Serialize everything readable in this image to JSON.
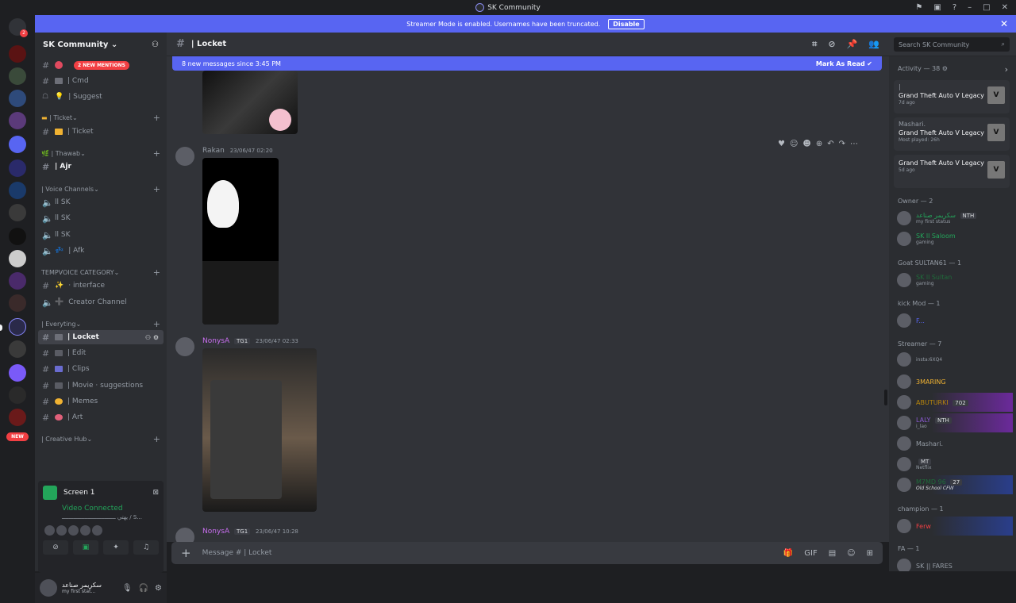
{
  "window": {
    "title": "SK Community"
  },
  "banner": {
    "text": "Streamer Mode is enabled. Usernames have been truncated.",
    "disable_label": "Disable"
  },
  "server": {
    "name": "SK Community"
  },
  "mentions_pill": "2 NEW MENTIONS",
  "channels_top": [
    {
      "label": "| Cmd"
    },
    {
      "label": "| Suggest"
    }
  ],
  "categories": [
    {
      "label": "| Ticket"
    },
    {
      "label": "| Thawab"
    },
    {
      "label": "| Voice Channels"
    },
    {
      "label": "TEMPVOICE CATEGORY"
    },
    {
      "label": "| Everyting"
    },
    {
      "label": "| Creative Hub"
    }
  ],
  "channels": {
    "ticket": "| Ticket",
    "ajr": "| Ajr",
    "voice1": "ll SK",
    "voice2": "ll SK",
    "voice3": "ll SK",
    "afk": "| Afk",
    "interface": "· interface",
    "creator": "Creator Channel",
    "locket": "| Locket",
    "edit": "| Edit",
    "clips": "| Clips",
    "movie": "| Movie · suggestions",
    "memes": "| Memes",
    "art": "| Art"
  },
  "voice": {
    "screen": "Screen 1",
    "status": "Video Connected",
    "sub": "يهتي ـــــــــــــــــــــــــــــــــ / S..."
  },
  "user": {
    "name": "سكريمر صناعد",
    "status": "my first stat..."
  },
  "header": {
    "channel": "| Locket",
    "search_placeholder": "Search SK Community"
  },
  "chat": {
    "new_messages": "8 new messages since 3:45 PM",
    "mark_read": "Mark As Read",
    "messages": [
      {
        "author": "Rakan",
        "time": "23/06/47 02:20"
      },
      {
        "author": "NonysA",
        "tag": "TG1",
        "time": "23/06/47 02:33"
      },
      {
        "author": "NonysA",
        "tag": "TG1",
        "time": "23/06/47 10:28"
      }
    ],
    "composer_placeholder": "Message #   | Locket"
  },
  "members": {
    "activity_header": "Activity — 38",
    "activities": [
      {
        "name": "|",
        "game": "Grand Theft Auto V Legacy",
        "time": "7d ago"
      },
      {
        "name": "Mashari.",
        "game": "Grand Theft Auto V Legacy",
        "time": "Most played: 26h"
      },
      {
        "name": "",
        "game": "Grand Theft Auto V Legacy",
        "time": "5d ago"
      }
    ],
    "roles": [
      {
        "label": "Owner — 2"
      },
      {
        "label": "Goat SULTAN61 — 1"
      },
      {
        "label": "kick Mod — 1"
      },
      {
        "label": "Streamer — 7"
      },
      {
        "label": "champion — 1"
      },
      {
        "label": "FA — 1"
      }
    ],
    "owner": [
      {
        "name": "سكريمر صناعد",
        "tag": "NTH",
        "status": "my first status"
      },
      {
        "name": "SK ll Saloom",
        "status": "gaming"
      }
    ],
    "goat": [
      {
        "name": "SK ll Sultan",
        "status": "gaming"
      }
    ],
    "kick": [
      {
        "name": "F..."
      }
    ],
    "streamer": [
      {
        "name": "",
        "status": "insta:6XQ4"
      },
      {
        "name": "3MARING",
        "status": ""
      },
      {
        "name": "ABUTURKI",
        "tag": "702"
      },
      {
        "name": "LALY",
        "tag": "NTH",
        "status": "i_lao"
      },
      {
        "name": "Mashari."
      },
      {
        "name": "",
        "tag": "MT",
        "status": "Netflix"
      },
      {
        "name": "M7MD 96",
        "tag": "27",
        "status": "Old School CFW"
      }
    ],
    "champion": [
      {
        "name": "Ferw"
      }
    ],
    "fa": [
      {
        "name": "SK || FARES"
      }
    ]
  }
}
